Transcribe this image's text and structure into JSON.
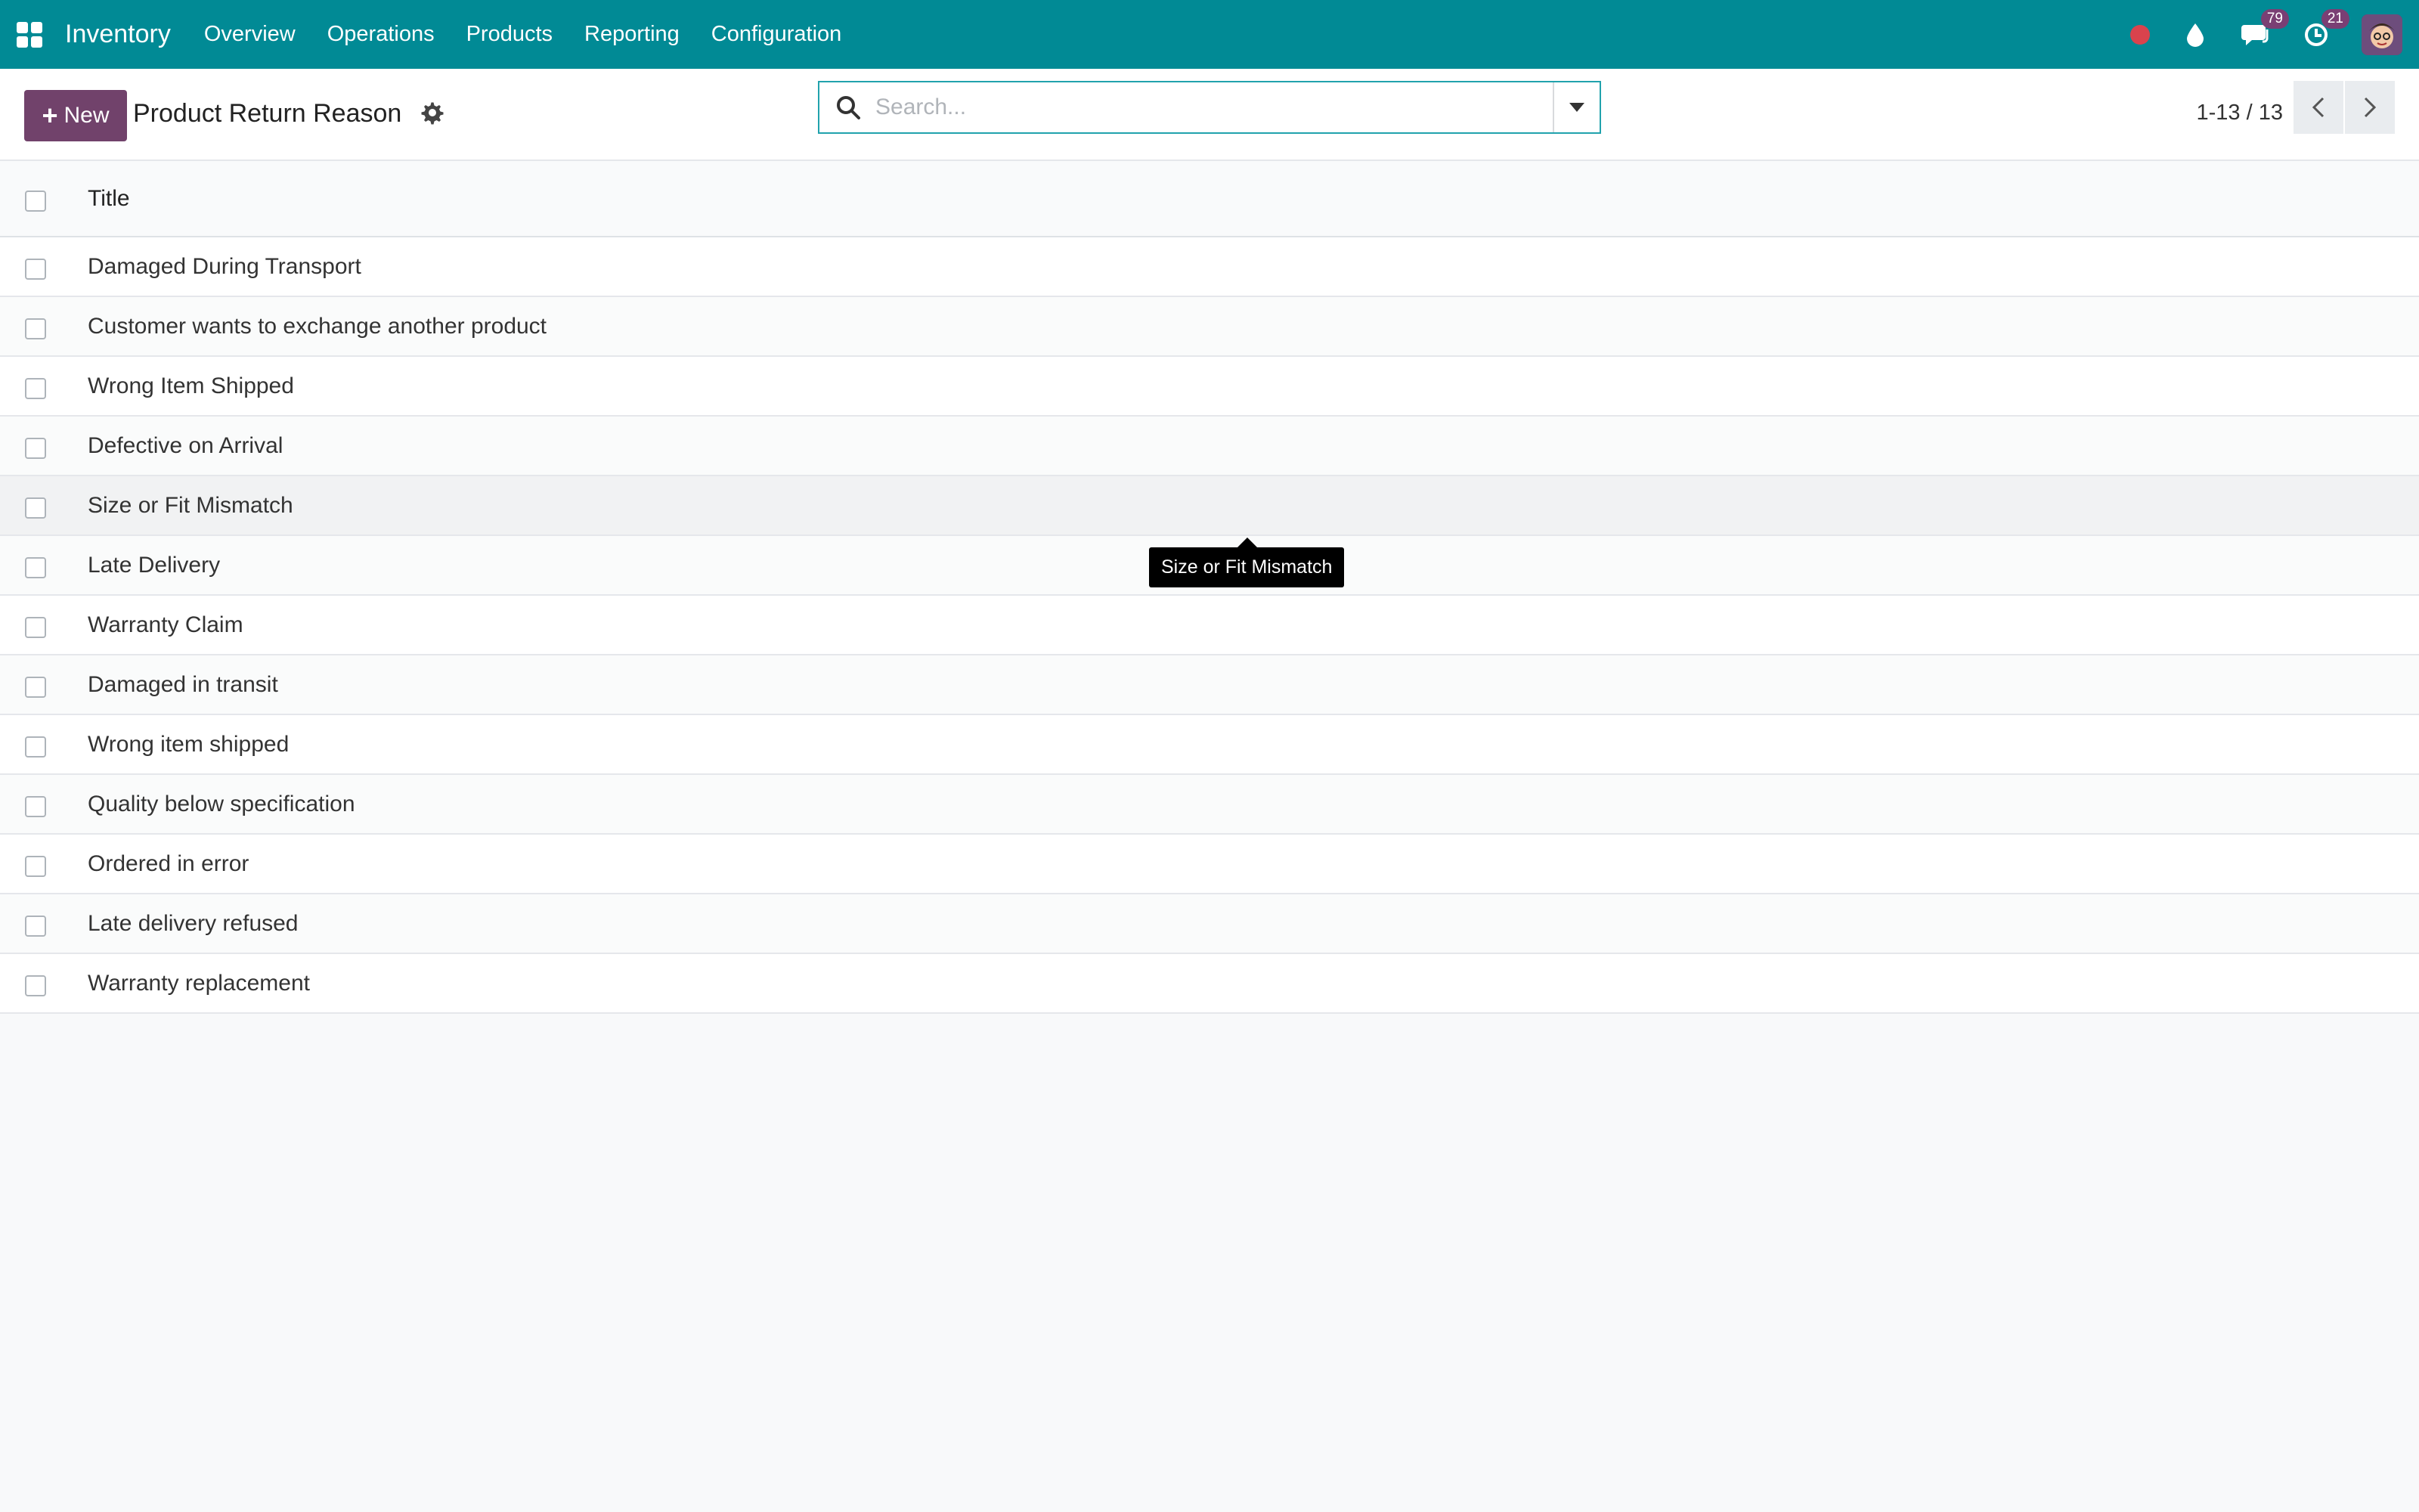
{
  "topbar": {
    "app_name": "Inventory",
    "nav": [
      "Overview",
      "Operations",
      "Products",
      "Reporting",
      "Configuration"
    ],
    "messages_count": "79",
    "activities_count": "21",
    "accent_color": "#018a95"
  },
  "control": {
    "new_label": "New",
    "page_title": "Product Return Reason",
    "search_placeholder": "Search...",
    "pager_text": "1-13 / 13"
  },
  "list": {
    "column_title": "Title",
    "rows": [
      "Damaged During Transport",
      "Customer wants to exchange another product",
      "Wrong Item Shipped",
      "Defective on Arrival",
      "Size or Fit Mismatch",
      "Late Delivery",
      "Warranty Claim",
      "Damaged in transit",
      "Wrong item shipped",
      "Quality below specification",
      "Ordered in error",
      "Late delivery refused",
      "Warranty replacement"
    ],
    "hovered_row_index": 4
  },
  "tooltip": {
    "text": "Size or Fit Mismatch"
  }
}
